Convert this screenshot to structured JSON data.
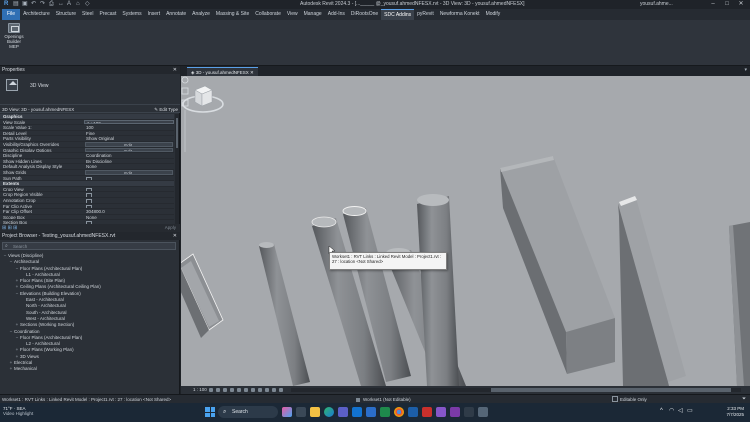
{
  "titlebar": {
    "title": "Autodesk Revit 2024.3 - [..._____ @_yousuf.ahmedNFESX.rvt - 3D View: 3D - yousuf.ahmedNFESX]",
    "user": "yousuf.ahme..."
  },
  "ribbon": {
    "tabs": [
      "File",
      "Architecture",
      "Structure",
      "Steel",
      "Precast",
      "Systems",
      "Insert",
      "Annotate",
      "Analyze",
      "Massing & Site",
      "Collaborate",
      "View",
      "Manage",
      "Add-Ins",
      "DiRootsOne",
      "SDC Addins",
      "pyRevit",
      "Newforma Konekt",
      "Modify"
    ],
    "active_tab": "SDC Addins",
    "tool_label_1": "Openings",
    "tool_label_2": "Builder",
    "panel_label": "MEP"
  },
  "properties": {
    "title": "Properties",
    "type_name": "3D View",
    "selector": "3D View: 3D - yousuf.ahmedNFESX",
    "edit_type": "Edit Type",
    "rows": [
      {
        "k": "Graphics",
        "v": "",
        "kind": "group"
      },
      {
        "k": "View Scale",
        "v": "1 : 100",
        "kind": "input"
      },
      {
        "k": "Scale Value    1:",
        "v": "100",
        "kind": "text"
      },
      {
        "k": "Detail Level",
        "v": "Fine",
        "kind": "text"
      },
      {
        "k": "Parts Visibility",
        "v": "Show Original",
        "kind": "text"
      },
      {
        "k": "Visibility/Graphics Overrides",
        "v": "Edit...",
        "kind": "btn"
      },
      {
        "k": "Graphic Display Options",
        "v": "Edit...",
        "kind": "btn"
      },
      {
        "k": "Discipline",
        "v": "Coordination",
        "kind": "text"
      },
      {
        "k": "Show Hidden Lines",
        "v": "By Discipline",
        "kind": "text"
      },
      {
        "k": "Default Analysis Display Style",
        "v": "None",
        "kind": "text"
      },
      {
        "k": "Show Grids",
        "v": "Edit...",
        "kind": "btn"
      },
      {
        "k": "Sun Path",
        "v": "",
        "kind": "chk"
      },
      {
        "k": "Extents",
        "v": "",
        "kind": "group"
      },
      {
        "k": "Crop View",
        "v": "",
        "kind": "chk"
      },
      {
        "k": "Crop Region Visible",
        "v": "",
        "kind": "chk"
      },
      {
        "k": "Annotation Crop",
        "v": "",
        "kind": "chk"
      },
      {
        "k": "Far Clip Active",
        "v": "",
        "kind": "chk"
      },
      {
        "k": "Far Clip Offset",
        "v": "304800.0",
        "kind": "text"
      },
      {
        "k": "Scope Box",
        "v": "None",
        "kind": "text"
      },
      {
        "k": "Section Box",
        "v": "",
        "kind": "chk"
      }
    ],
    "apply": "Apply"
  },
  "project_browser": {
    "title": "Project Browser - Testing_yousuf.ahmedNFESX.rvt",
    "search_placeholder": "Search",
    "nodes": [
      {
        "t": "Views (Discipline)",
        "d": 0,
        "tw": "−"
      },
      {
        "t": "Architectural",
        "d": 1,
        "tw": "−"
      },
      {
        "t": "Floor Plans (Architectural Plan)",
        "d": 2,
        "tw": "−"
      },
      {
        "t": "L1 - Architectural",
        "d": 3,
        "tw": ""
      },
      {
        "t": "Floor Plans (Site Plan)",
        "d": 2,
        "tw": "+"
      },
      {
        "t": "Ceiling Plans (Architectural Ceiling Plan)",
        "d": 2,
        "tw": "+"
      },
      {
        "t": "Elevations (Building Elevation)",
        "d": 2,
        "tw": "−"
      },
      {
        "t": "East - Architectural",
        "d": 3,
        "tw": ""
      },
      {
        "t": "North - Architectural",
        "d": 3,
        "tw": ""
      },
      {
        "t": "South - Architectural",
        "d": 3,
        "tw": ""
      },
      {
        "t": "West - Architectural",
        "d": 3,
        "tw": ""
      },
      {
        "t": "Sections (Working Section)",
        "d": 2,
        "tw": "+"
      },
      {
        "t": "Coordination",
        "d": 1,
        "tw": "−"
      },
      {
        "t": "Floor Plans (Architectural Plan)",
        "d": 2,
        "tw": "−"
      },
      {
        "t": "L2 - Architectural",
        "d": 3,
        "tw": ""
      },
      {
        "t": "Floor Plans (Working Plan)",
        "d": 2,
        "tw": "+"
      },
      {
        "t": "3D Views",
        "d": 2,
        "tw": "+"
      },
      {
        "t": "Electrical",
        "d": 1,
        "tw": "+"
      },
      {
        "t": "Mechanical",
        "d": 1,
        "tw": "+"
      }
    ]
  },
  "view_tab": {
    "label": "3D - yousuf.ahmedNFESX"
  },
  "tooltip": {
    "line1": "Workset1 : RVT Links : Linked Revit Model : Project1.rvt :",
    "line2": "27 : location <Not Shared>"
  },
  "view_control": {
    "scale": "1 : 100"
  },
  "statusbar": {
    "message": "Workset1 : RVT Links : Linked Revit Model : Project1.rvt : 27 : location <Not Shared>",
    "workset": "Workset1 (Not Editable)",
    "editable_only": "Editable Only"
  },
  "taskbar": {
    "weather_temp": "71°F · SEA",
    "weather_desc": "Video Highlight",
    "search_placeholder": "Search",
    "time": "2:33 PM",
    "date": "7/7/2025"
  },
  "colors": {
    "accent": "#2f6fb4",
    "viewport_bg": "#a6a9ad"
  }
}
